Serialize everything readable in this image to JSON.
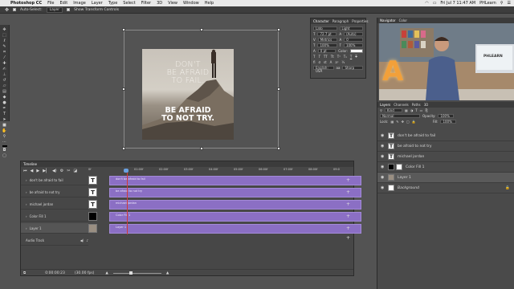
{
  "menubar": {
    "app": "Photoshop CC",
    "menus": [
      "File",
      "Edit",
      "Image",
      "Layer",
      "Type",
      "Select",
      "Filter",
      "3D",
      "View",
      "Window",
      "Help"
    ],
    "clock": "Fri Jul 7 11:47 AM",
    "user": "PHLearn"
  },
  "options": {
    "auto_select": "Auto-Select:",
    "auto_select_value": "Layer",
    "show_transform": "Show Transform Controls"
  },
  "artwork": {
    "line1a": "DON'T",
    "line1b": "BE AFRAID",
    "line1c": "TO FAIL.",
    "line2a": "BE AFRAID",
    "line2b": "TO NOT TRY."
  },
  "character_panel": {
    "tabs": [
      "Character",
      "Paragraph",
      "Properties"
    ],
    "font_family": "Lato",
    "font_style": "Light",
    "size": "72.7 pt",
    "leading": "(Auto)",
    "tracking": "Metrics",
    "kerning": "0",
    "vscale": "100%",
    "hscale": "100%",
    "baseline": "0 pt",
    "color_label": "Color:",
    "language": "English: USA",
    "aa_label": "aa",
    "aa_value": "Sharp"
  },
  "navigator": {
    "tabs": [
      "Navigator",
      "Color"
    ],
    "sign_letter": "A",
    "monitor_text": "PHLEARN"
  },
  "layers_panel": {
    "tabs": [
      "Layers",
      "Channels",
      "Paths",
      "3D"
    ],
    "filter_label": "Kind",
    "blend_mode": "Normal",
    "opacity_label": "Opacity:",
    "opacity_value": "100%",
    "lock_label": "Lock:",
    "fill_label": "Fill:",
    "fill_value": "100%",
    "layers": [
      {
        "name": "don't be afraid to fail",
        "kind": "text"
      },
      {
        "name": "be afraid to not try",
        "kind": "text"
      },
      {
        "name": "michael jordan",
        "kind": "text"
      },
      {
        "name": "Color Fill 1",
        "kind": "fill"
      },
      {
        "name": "Layer 1",
        "kind": "image",
        "selected": true
      },
      {
        "name": "Background",
        "kind": "background"
      }
    ]
  },
  "timeline": {
    "title": "Timeline",
    "ruler": [
      "0f",
      "01:00f",
      "02:00f",
      "03:00f",
      "04:00f",
      "05:00f",
      "06:00f",
      "07:00f",
      "08:00f",
      "09:0"
    ],
    "tracks": [
      {
        "label": "don't be afraid to fail",
        "clip": "don't be afraid to fail"
      },
      {
        "label": "be afraid to not try",
        "clip": "be afraid to not try"
      },
      {
        "label": "michael jordan",
        "clip": "michael jordan"
      },
      {
        "label": "Color Fill 1",
        "clip": "Color Fill 1"
      },
      {
        "label": "Layer 1",
        "clip": "Layer 1"
      }
    ],
    "audio_label": "Audio Track",
    "timecode": "0:00:00:23",
    "fps": "(30.00 fps)"
  },
  "colors": {
    "clip": "#8b6fc4",
    "playhead": "#d03a3a",
    "panel_bg": "#4a4a4a",
    "app_bg": "#535353"
  }
}
